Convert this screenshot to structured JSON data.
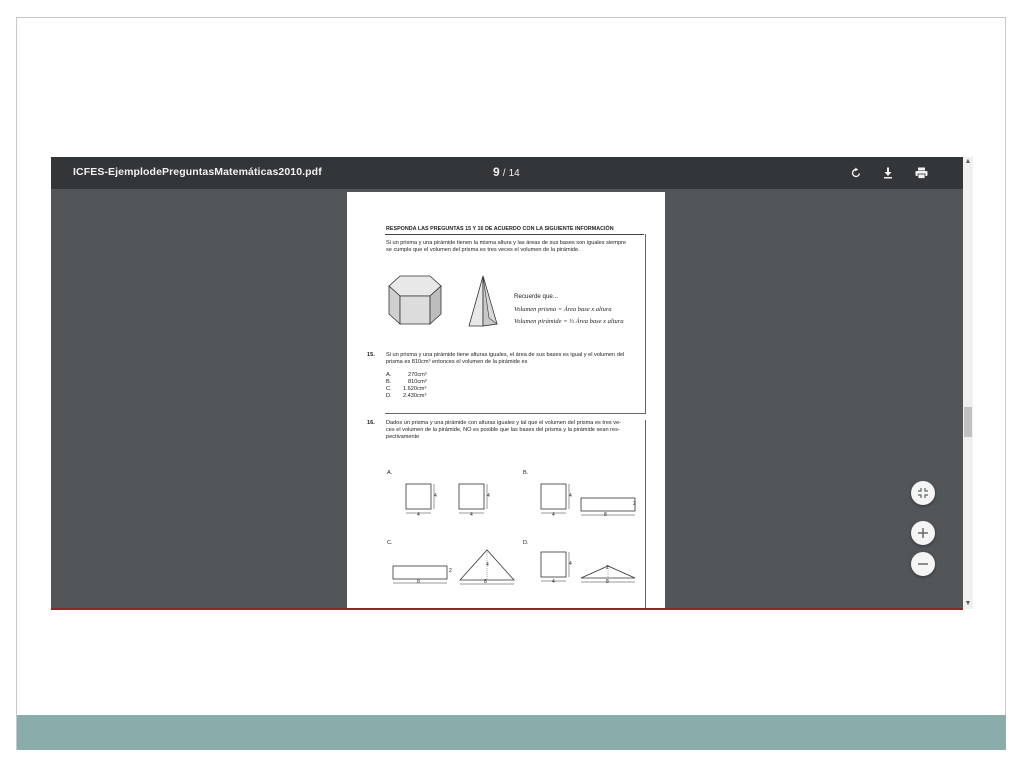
{
  "toolbar": {
    "title": "ICFES-EjemplodePreguntasMatemáticas2010.pdf",
    "page_current": "9",
    "page_separator": "/",
    "page_total": "14",
    "icons": [
      "rotate-icon",
      "download-icon",
      "print-icon"
    ]
  },
  "fabs": {
    "icons": [
      "fit-page-icon",
      "zoom-in-icon",
      "zoom-out-icon"
    ]
  },
  "pdf_page": {
    "heading": "RESPONDA LAS PREGUNTAS 15 Y 16 DE ACUERDO CON LA SIGUIENTE INFORMACIÓN",
    "intro_line1": "Si un prisma y una pirámide tienen la misma altura y las áreas de sus bases son iguales siempre",
    "intro_line2": "se cumple que el volumen del prisma es tres veces el volumen de la pirámide.",
    "recall_title": "Recuerde que...",
    "formula_prism": "Volumen prisma = Área base x altura",
    "formula_pyramid": "Volumen pirámide = ⅓ Área base x altura",
    "q15_number": "15.",
    "q15_line1": "Si un prisma y una pirámide tiene alturas iguales, el área de sus bases es igual y el volumen del",
    "q15_line2": "prisma es 810cm³ entonces el volumen de la pirámide es",
    "q15_options": [
      {
        "letter": "A.",
        "text": "270cm³"
      },
      {
        "letter": "B.",
        "text": "810cm³"
      },
      {
        "letter": "C.",
        "text": "1.620cm³"
      },
      {
        "letter": "D.",
        "text": "2.430cm³"
      }
    ],
    "q16_number": "16.",
    "q16_line1": "Dados un prisma y una pirámide con alturas iguales y tal que el volumen del prisma es tres ve-",
    "q16_line2": "ces el volumen de la pirámide, NO es posible que las bases del prisma y la pirámide sean res-",
    "q16_line3": "pectivamente",
    "option_labels": [
      "A.",
      "B.",
      "C.",
      "D."
    ],
    "dims": {
      "four": "4",
      "eight": "8",
      "two": "2"
    }
  }
}
